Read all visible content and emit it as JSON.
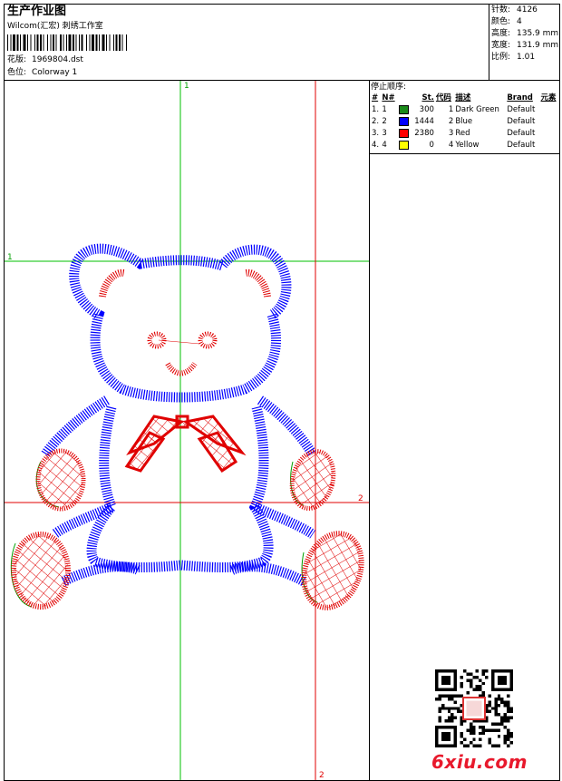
{
  "header": {
    "title": "生产作业图",
    "company": "Wilcom(汇宏) 刺绣工作室",
    "design_label": "花版:",
    "design_file": "1969804.dst",
    "colorway_label": "色位:",
    "colorway": "Colorway 1"
  },
  "stats": [
    {
      "label": "针数:",
      "value": "4126"
    },
    {
      "label": "颜色:",
      "value": "4"
    },
    {
      "label": "高度:",
      "value": "135.9 mm"
    },
    {
      "label": "宽度:",
      "value": "131.9 mm"
    },
    {
      "label": "比例:",
      "value": "1.01"
    }
  ],
  "stop_sequence": {
    "title": "停止顺序:",
    "columns": [
      "#",
      "N#",
      "St.",
      "代码",
      "描述",
      "Brand",
      "元素"
    ],
    "rows": [
      {
        "no": "1.",
        "n": "1",
        "color": "#1a8a1a",
        "st": "300",
        "code": "1",
        "desc": "Dark Green",
        "brand": "Default"
      },
      {
        "no": "2.",
        "n": "2",
        "color": "#0000ff",
        "st": "1444",
        "code": "2",
        "desc": "Blue",
        "brand": "Default"
      },
      {
        "no": "3.",
        "n": "3",
        "color": "#ff0000",
        "st": "2380",
        "code": "3",
        "desc": "Red",
        "brand": "Default"
      },
      {
        "no": "4.",
        "n": "4",
        "color": "#ffff00",
        "st": "0",
        "code": "4",
        "desc": "Yellow",
        "brand": "Default"
      }
    ]
  },
  "axes": {
    "v1_label": "1",
    "h1_label": "1",
    "h2_label": "2",
    "v2_label": "2"
  },
  "logo": "6xiu.com",
  "colors": {
    "green": "#00c000",
    "red": "#e00000",
    "blue": "#0000ff"
  }
}
